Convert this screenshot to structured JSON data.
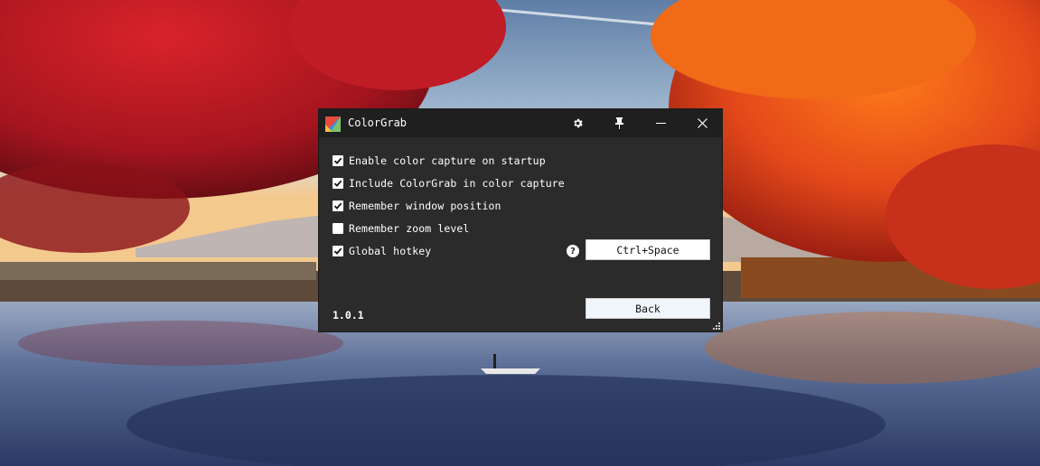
{
  "window": {
    "title": "ColorGrab",
    "icons": {
      "logo": "colorgrab-logo-icon",
      "settings": "gear-icon",
      "pin": "pin-icon",
      "minimize": "minimize-icon",
      "close": "close-icon"
    }
  },
  "options": [
    {
      "label": "Enable color capture on startup",
      "checked": true
    },
    {
      "label": "Include ColorGrab in color capture",
      "checked": true
    },
    {
      "label": "Remember window position",
      "checked": true
    },
    {
      "label": "Remember zoom level",
      "checked": false
    },
    {
      "label": "Global hotkey",
      "checked": true
    }
  ],
  "hotkey": {
    "value": "Ctrl+Space",
    "help_glyph": "?"
  },
  "back_label": "Back",
  "version": "1.0.1",
  "colors": {
    "window_bg": "#2b2b2b",
    "titlebar_bg": "#1f1f1f",
    "text": "#ffffff"
  }
}
